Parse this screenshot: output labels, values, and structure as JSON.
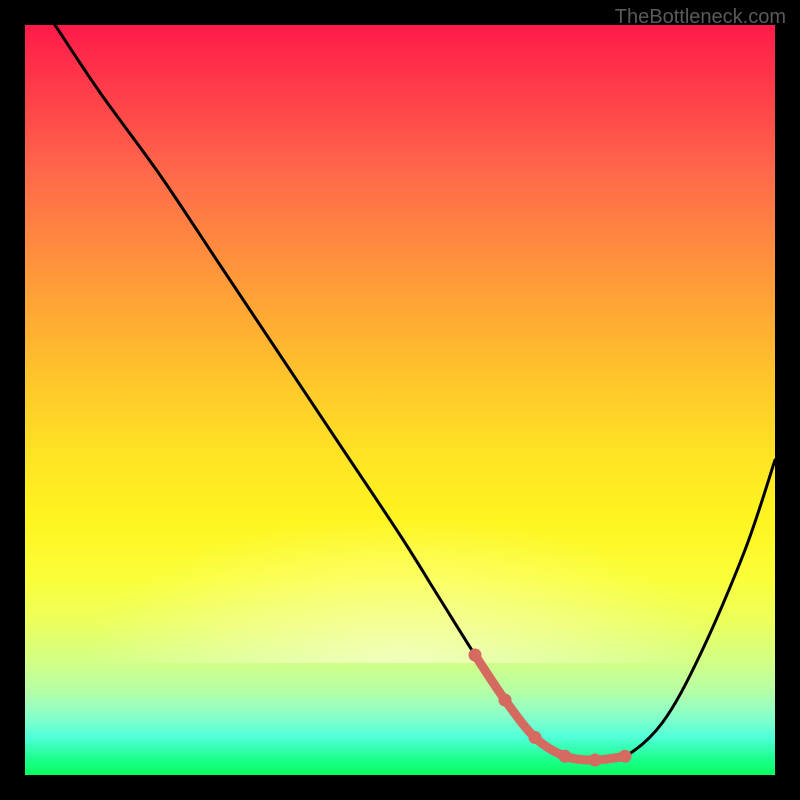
{
  "watermark": "TheBottleneck.com",
  "chart_data": {
    "type": "line",
    "title": "",
    "xlabel": "",
    "ylabel": "",
    "xlim": [
      0,
      100
    ],
    "ylim": [
      0,
      100
    ],
    "series": [
      {
        "name": "bottleneck-curve",
        "x": [
          4,
          10,
          18,
          26,
          34,
          42,
          50,
          55,
          60,
          64,
          68,
          72,
          76,
          80,
          85,
          90,
          96,
          100
        ],
        "values": [
          100,
          91,
          80,
          68,
          56,
          44,
          32,
          24,
          16,
          10,
          5,
          2.5,
          2,
          2.5,
          7,
          16,
          30,
          42
        ]
      }
    ],
    "markers": {
      "name": "highlight-region",
      "color": "#d46a60",
      "x": [
        60,
        64,
        68,
        72,
        76,
        80
      ],
      "values": [
        16,
        10,
        5,
        2.5,
        2,
        2.5
      ]
    },
    "background": {
      "top_color": "#ff1a4a",
      "mid_color": "#ffe524",
      "bottom_color": "#0aff60"
    }
  }
}
